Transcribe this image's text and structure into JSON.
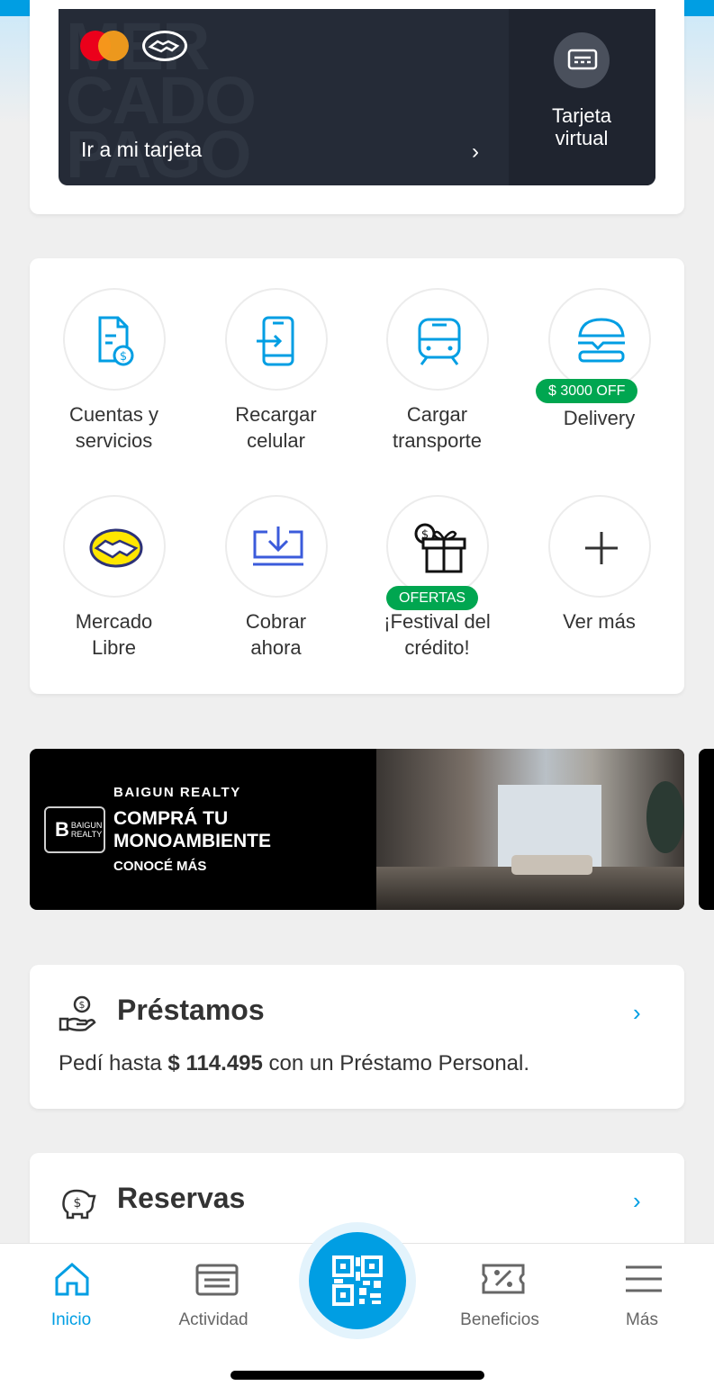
{
  "card": {
    "watermark": "MER\nCADO\nPAGO",
    "link_label": "Ir a mi tarjeta",
    "chevron": "›",
    "virtual_label_1": "Tarjeta",
    "virtual_label_2": "virtual"
  },
  "shortcuts": [
    {
      "line1": "Cuentas y",
      "line2": "servicios",
      "badge": ""
    },
    {
      "line1": "Recargar",
      "line2": "celular",
      "badge": ""
    },
    {
      "line1": "Cargar",
      "line2": "transporte",
      "badge": ""
    },
    {
      "line1": "Delivery",
      "line2": "",
      "badge": "$ 3000 OFF"
    },
    {
      "line1": "Mercado",
      "line2": "Libre",
      "badge": ""
    },
    {
      "line1": "Cobrar",
      "line2": "ahora",
      "badge": ""
    },
    {
      "line1": "¡Festival del",
      "line2": "crédito!",
      "badge": "OFERTAS"
    },
    {
      "line1": "Ver más",
      "line2": "",
      "badge": ""
    }
  ],
  "banner": {
    "brand": "BAIGUN REALTY",
    "headline_1": "COMPRÁ TU",
    "headline_2": "MONOAMBIENTE",
    "cta": "CONOCÉ MÁS",
    "logo_text_1": "BAIGUN",
    "logo_text_2": "REALTY"
  },
  "loans": {
    "title": "Préstamos",
    "text_before": "Pedí hasta ",
    "amount": "$ 114.495",
    "text_after": " con un Préstamo Personal."
  },
  "reservas": {
    "title": "Reservas"
  },
  "bottom_nav": {
    "items": [
      {
        "label": "Inicio",
        "icon": "home-icon"
      },
      {
        "label": "Actividad",
        "icon": "activity-icon"
      },
      {
        "label": "Beneficios",
        "icon": "benefits-icon"
      },
      {
        "label": "Más",
        "icon": "menu-icon"
      }
    ],
    "center_icon": "qr-icon"
  },
  "colors": {
    "brand_blue": "#009ee3",
    "badge_green": "#00a650",
    "card_dark": "#252b37"
  }
}
